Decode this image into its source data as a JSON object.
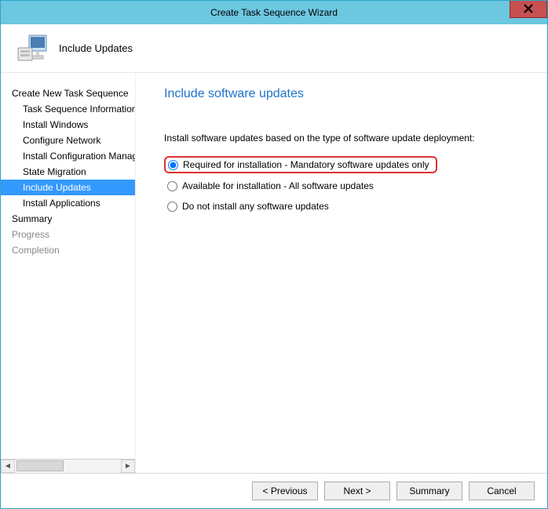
{
  "titlebar": {
    "title": "Create Task Sequence Wizard"
  },
  "header": {
    "label": "Include Updates"
  },
  "sidebar": {
    "items": [
      {
        "label": "Create New Task Sequence",
        "child": false
      },
      {
        "label": "Task Sequence Information",
        "child": true
      },
      {
        "label": "Install Windows",
        "child": true
      },
      {
        "label": "Configure Network",
        "child": true
      },
      {
        "label": "Install Configuration Manager",
        "child": true
      },
      {
        "label": "State Migration",
        "child": true
      },
      {
        "label": "Include Updates",
        "child": true,
        "active": true
      },
      {
        "label": "Install Applications",
        "child": true
      },
      {
        "label": "Summary",
        "child": false
      },
      {
        "label": "Progress",
        "child": false,
        "disabled": true
      },
      {
        "label": "Completion",
        "child": false,
        "disabled": true
      }
    ]
  },
  "main": {
    "heading": "Include software updates",
    "instruction": "Install software updates based on the type of software update deployment:",
    "options": [
      {
        "label": "Required for installation - Mandatory software updates only",
        "selected": true,
        "highlight": true
      },
      {
        "label": "Available for installation - All software updates",
        "selected": false
      },
      {
        "label": "Do not install any software updates",
        "selected": false
      }
    ]
  },
  "footer": {
    "previous": "< Previous",
    "next": "Next >",
    "summary": "Summary",
    "cancel": "Cancel"
  }
}
